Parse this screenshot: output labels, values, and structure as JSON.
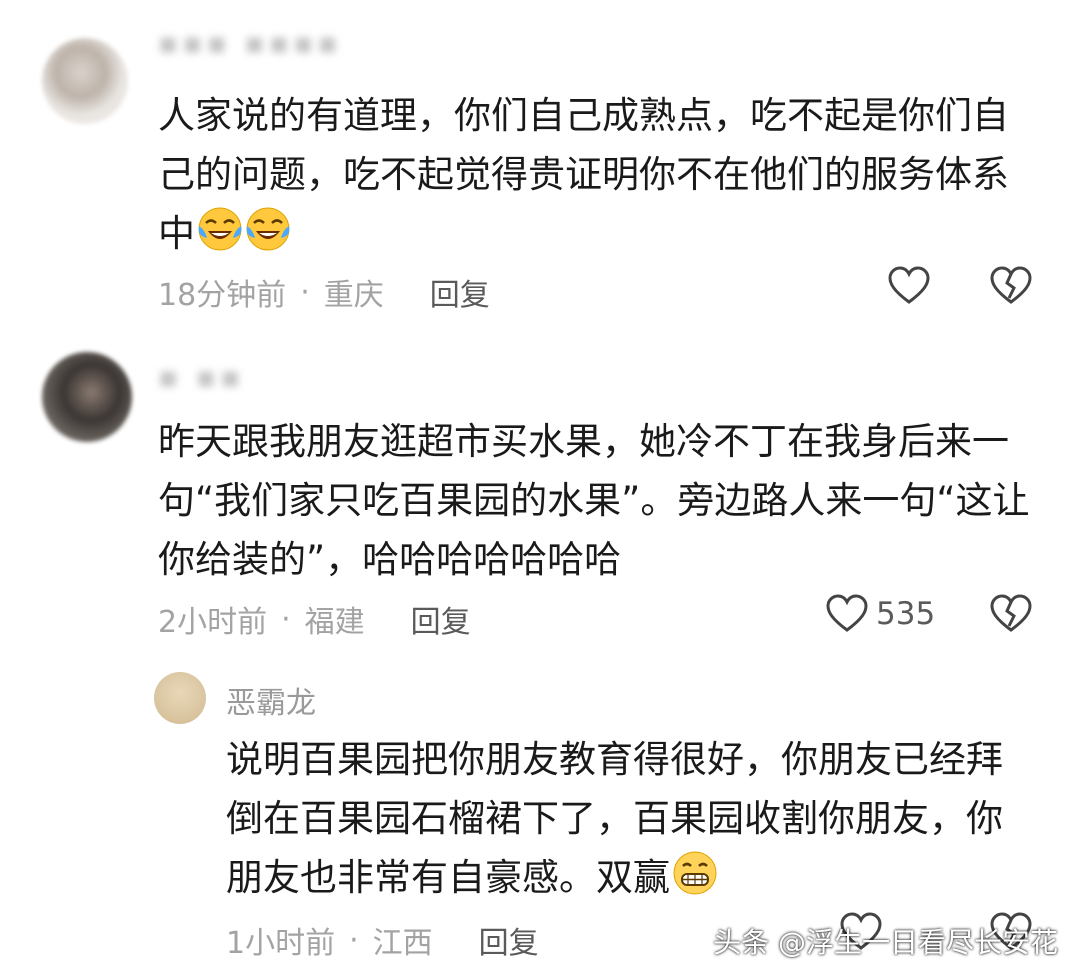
{
  "comments": [
    {
      "username": "▪▪▪ ▪▪▪▪",
      "text": "人家说的有道理，你们自己成熟点，吃不起是你们自己的问题，吃不起觉得贵证明你不在他们的服务体系中",
      "emoji": [
        "laughing-crying-emoji",
        "laughing-crying-emoji"
      ],
      "time": "18分钟前",
      "location": "重庆",
      "reply_label": "回复",
      "likes": ""
    },
    {
      "username": "▪ ▪▪",
      "text": "昨天跟我朋友逛超市买水果，她冷不丁在我身后来一句“我们家只吃百果园的水果”。旁边路人来一句“这让你给装的”，哈哈哈哈哈哈哈",
      "time": "2小时前",
      "location": "福建",
      "reply_label": "回复",
      "likes": "535",
      "replies": [
        {
          "username": "恶霸龙",
          "text": "说明百果园把你朋友教育得很好，你朋友已经拜倒在百果园石榴裙下了，百果园收割你朋友，你朋友也非常有自豪感。双赢",
          "emoji": [
            "grinning-emoji"
          ],
          "time": "1小时前",
          "location": "江西",
          "reply_label": "回复"
        }
      ]
    }
  ],
  "meta_separator": "·",
  "watermark": "头条 @浮生一日看尽长安花",
  "colors": {
    "meta": "#a3a3a3",
    "reply": "#5a5a5a",
    "text": "#1a1a1a"
  }
}
